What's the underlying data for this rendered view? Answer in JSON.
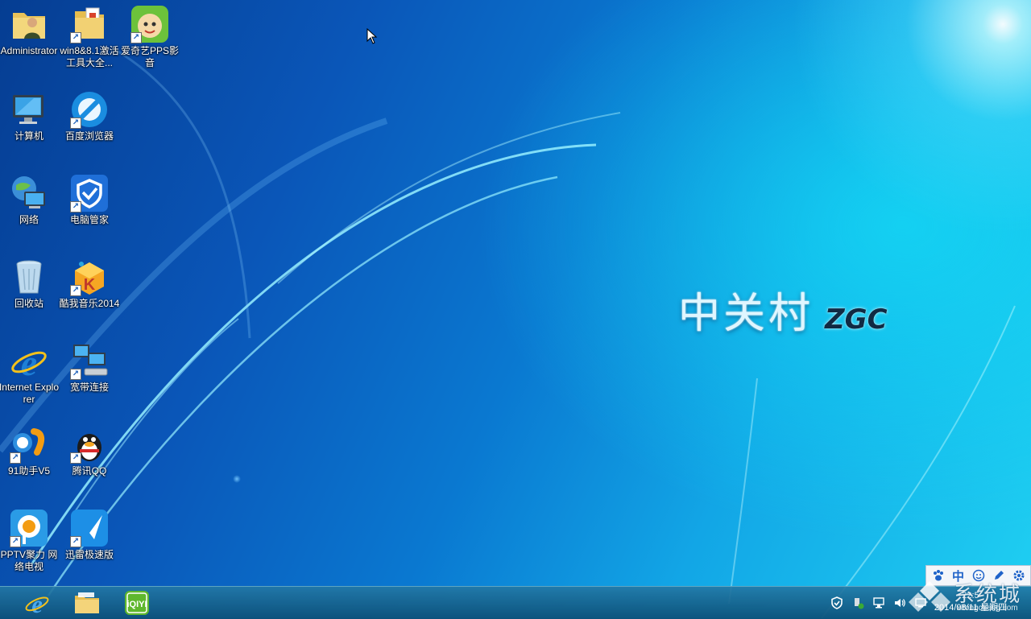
{
  "desktop": {
    "brand": {
      "cn": "中关村",
      "en": "ZGC"
    },
    "icons": [
      {
        "label": "Administrator",
        "icon": "user-folder-icon"
      },
      {
        "label": "win8&8.1激活工具大全...",
        "icon": "folder-shortcut-icon"
      },
      {
        "label": "爱奇艺PPS影音",
        "icon": "pps-player-icon"
      },
      {
        "label": "计算机",
        "icon": "computer-icon"
      },
      {
        "label": "百度浏览器",
        "icon": "baidu-browser-icon"
      },
      {
        "label": "网络",
        "icon": "network-icon"
      },
      {
        "label": "电脑管家",
        "icon": "pc-manager-icon"
      },
      {
        "label": "回收站",
        "icon": "recycle-bin-icon"
      },
      {
        "label": "酷我音乐2014",
        "icon": "kuwo-music-icon"
      },
      {
        "label": "Internet Explorer",
        "icon": "ie-icon"
      },
      {
        "label": "宽带连接",
        "icon": "broadband-connection-icon"
      },
      {
        "label": "91助手V5",
        "icon": "91-assistant-icon"
      },
      {
        "label": "腾讯QQ",
        "icon": "qq-penguin-icon"
      },
      {
        "label": "PPTV聚力 网络电视",
        "icon": "pptv-icon"
      },
      {
        "label": "迅雷极速版",
        "icon": "xunlei-icon"
      }
    ]
  },
  "taskbar": {
    "pinned": [
      {
        "name": "Internet Explorer",
        "icon": "ie-icon"
      },
      {
        "name": "File Explorer",
        "icon": "file-explorer-icon"
      },
      {
        "name": "iQIYI",
        "icon": "iqiyi-icon"
      }
    ],
    "ime": {
      "mode": "中"
    },
    "clock": {
      "time": "22:5",
      "date": "2014/08/11 星期四"
    }
  },
  "watermark": {
    "text": "系统城",
    "url": "xitongcheng.com"
  },
  "colors": {
    "accent": "#1f63c9",
    "taskbar": "#1d6e9a"
  }
}
